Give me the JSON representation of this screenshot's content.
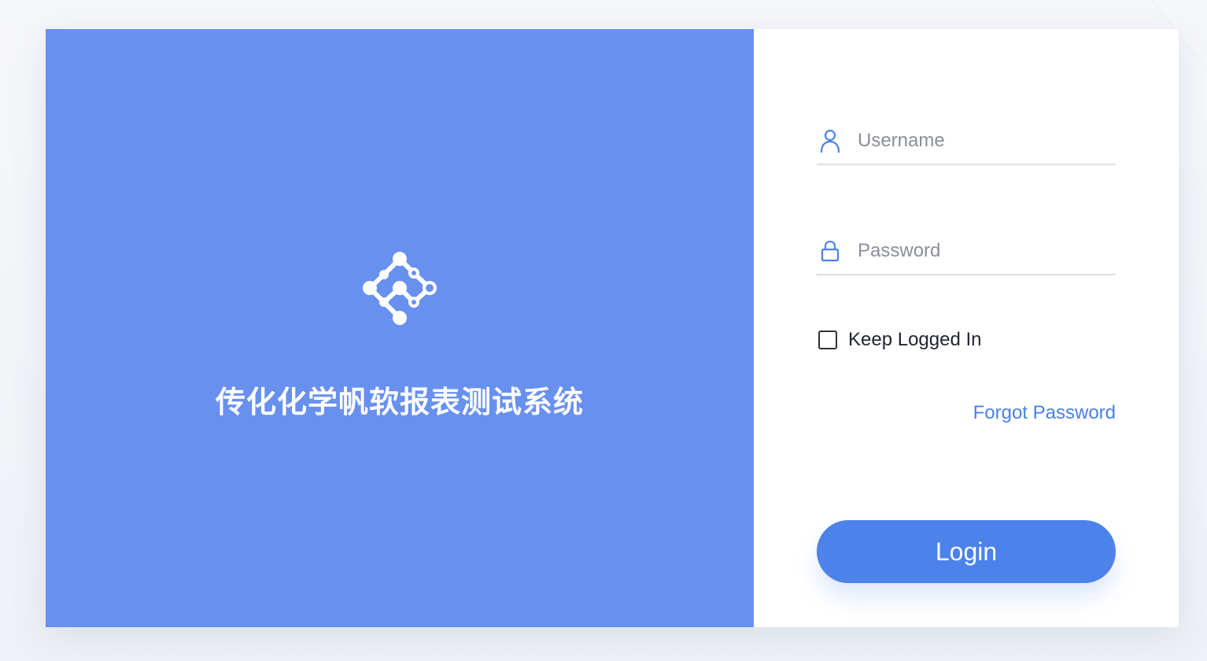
{
  "brand": {
    "system_title": "传化化学帆软报表测试系统",
    "logo_icon": "molecule-network-icon",
    "panel_color": "#6890ee"
  },
  "login_form": {
    "username": {
      "icon": "user-icon",
      "placeholder": "Username",
      "value": ""
    },
    "password": {
      "icon": "lock-icon",
      "placeholder": "Password",
      "value": ""
    },
    "keep_logged_in": {
      "label": "Keep Logged In",
      "checked": false
    },
    "forgot_password_label": "Forgot Password",
    "login_button_label": "Login",
    "accent_color": "#4c82e9"
  }
}
